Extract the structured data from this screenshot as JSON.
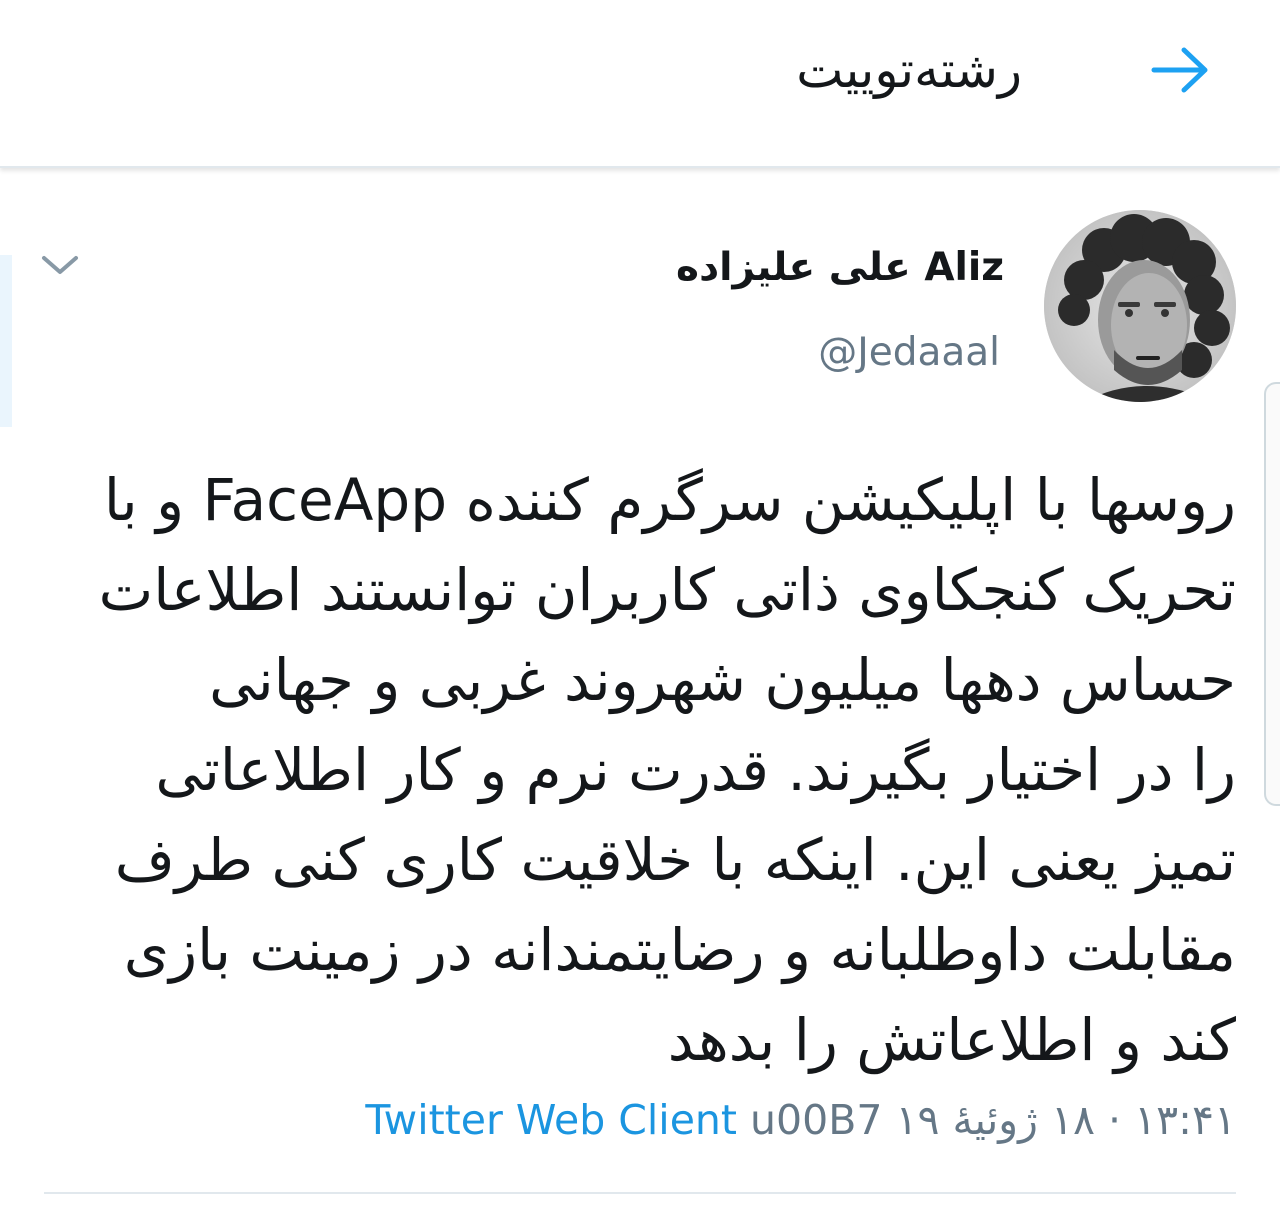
{
  "header": {
    "title": "رشته‌توییت",
    "back_icon": "arrow-right-icon",
    "accent_color": "#1da1f2"
  },
  "tweet": {
    "display_name": "علی علیزاده Aliz",
    "handle": "@Jedaaal",
    "more_icon": "chevron-down-icon",
    "lines": [
      "روسها با اپلیکیشن سرگرم کننده FaceApp و با",
      "تحریک کنجکاوی ذاتی کاربران توانستند اطلاعات",
      "حساس دهها میلیون شهروند غربی و جهانی",
      "را در اختیار بگیرند. قدرت نرم و کار اطلاعاتی",
      "تمیز یعنی این. اینکه با خلاقیت کاری کنی طرف",
      "مقابلت داوطلبانه و رضایتمندانه در زمینت بازی",
      "کند و اطلاعاتش را بدهد"
    ],
    "client": "Twitter Web Client",
    "separator": "u00B7",
    "datetime": "۱۳:۴۱ · ۱۸ ژوئیهٔ ۱۹",
    "link_color": "#1b95e0"
  }
}
